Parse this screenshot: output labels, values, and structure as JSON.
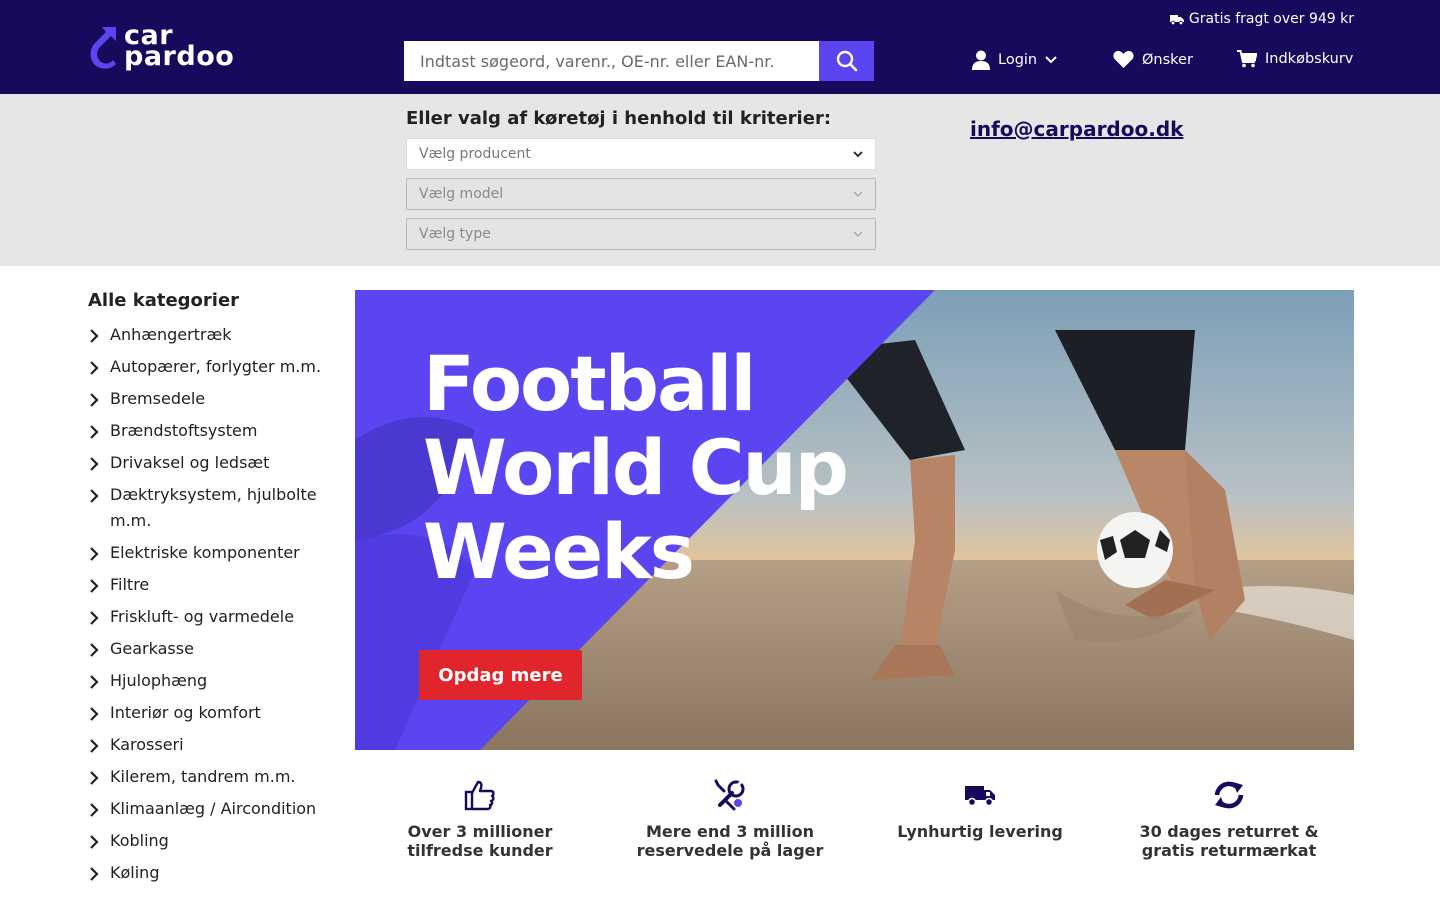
{
  "header": {
    "logo": {
      "line1": "car",
      "line2": "pardoo"
    },
    "free_shipping": "Gratis fragt over 949 kr",
    "search_placeholder": "Indtast søgeord, varenr., OE-nr. eller EAN-nr.",
    "login_label": "Login",
    "wishlist_label": "Ønsker",
    "cart_label": "Indkøbskurv",
    "colors": {
      "navy": "#170a5c",
      "accent": "#5b45f0",
      "cta_red": "#e0262c"
    }
  },
  "vehicle_selector": {
    "title": "Eller valg af køretøj i henhold til kriterier:",
    "producer_placeholder": "Vælg producent",
    "model_placeholder": "Vælg model",
    "type_placeholder": "Vælg type",
    "email": "info@carpardoo.dk"
  },
  "categories": {
    "title": "Alle kategorier",
    "items": [
      "Anhængertræk",
      "Autopærer, forlygter m.m.",
      "Bremsedele",
      "Brændstoftsystem",
      "Drivaksel og ledsæt",
      "Dæktryksystem, hjulbolte m.m.",
      "Elektriske komponenter",
      "Filtre",
      "Friskluft- og varmedele",
      "Gearkasse",
      "Hjulophæng",
      "Interiør og komfort",
      "Karosseri",
      "Kilerem, tandrem m.m.",
      "Klimaanlæg / Aircondition",
      "Kobling",
      "Køling"
    ]
  },
  "banner": {
    "headline_1": "Football",
    "headline_2": "World Cup",
    "headline_3": "Weeks",
    "cta": "Opdag mere"
  },
  "features": [
    {
      "icon": "thumbs-up-icon",
      "text": "Over 3 millioner tilfredse kunder"
    },
    {
      "icon": "tools-icon",
      "text": "Mere end 3 million reservedele på lager"
    },
    {
      "icon": "truck-icon",
      "text": "Lynhurtig levering"
    },
    {
      "icon": "refresh-icon",
      "text": "30 dages returret & gratis returmærkat"
    }
  ]
}
